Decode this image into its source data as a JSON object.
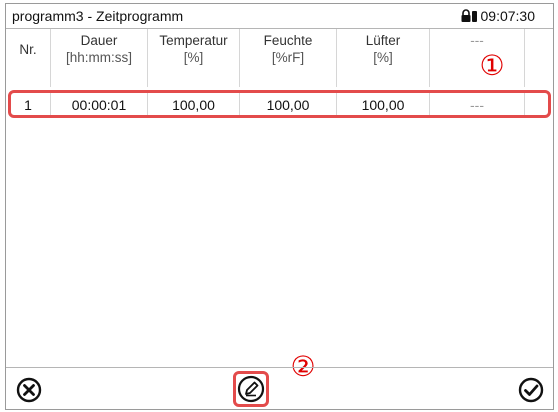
{
  "header": {
    "title": "programm3 - Zeitprogramm",
    "time": "09:07:30",
    "lock_icon": "padlock-icon"
  },
  "table": {
    "columns": [
      {
        "label": "Nr.",
        "unit": ""
      },
      {
        "label": "Dauer",
        "unit": "[hh:mm:ss]"
      },
      {
        "label": "Temperatur",
        "unit": "[%]"
      },
      {
        "label": "Feuchte",
        "unit": "[%rF]"
      },
      {
        "label": "Lüfter",
        "unit": "[%]"
      },
      {
        "label": "---",
        "unit": ""
      }
    ],
    "rows": [
      {
        "nr": "1",
        "dauer": "00:00:01",
        "temperatur": "100,00",
        "feuchte": "100,00",
        "luefter": "100,00",
        "extra": "---"
      }
    ]
  },
  "annotations": {
    "marker_1": "①",
    "marker_2": "②"
  },
  "footer": {
    "cancel_icon": "cancel-icon",
    "edit_icon": "edit-icon",
    "confirm_icon": "confirm-icon"
  },
  "colors": {
    "highlight": "#e34b4b",
    "marker": "#e00000"
  }
}
